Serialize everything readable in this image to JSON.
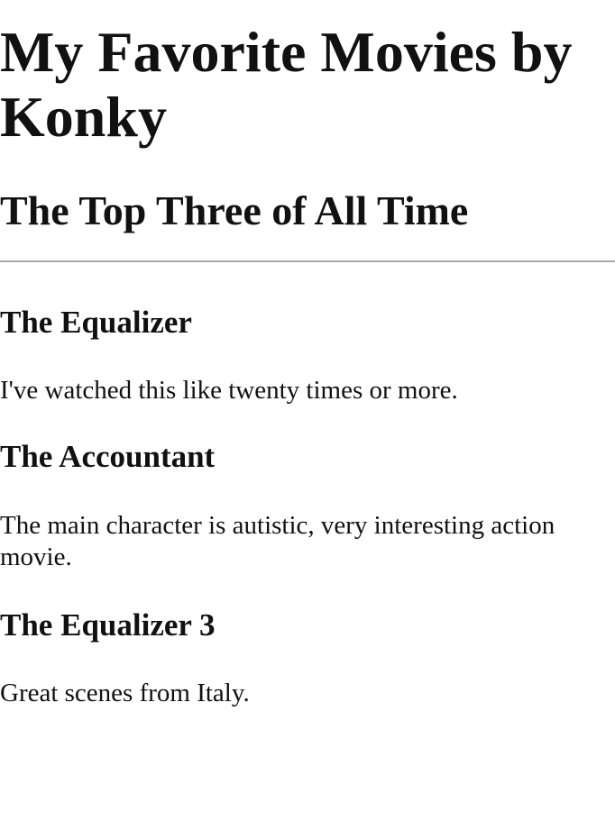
{
  "page": {
    "title": "My Favorite Movies by Konky",
    "subtitle": "The Top Three of All Time"
  },
  "movies": [
    {
      "title": "The Equalizer",
      "description": "I've watched this like twenty times or more."
    },
    {
      "title": "The Accountant",
      "description": "The main character is autistic, very interesting action movie."
    },
    {
      "title": "The Equalizer 3",
      "description": "Great scenes from Italy."
    }
  ]
}
